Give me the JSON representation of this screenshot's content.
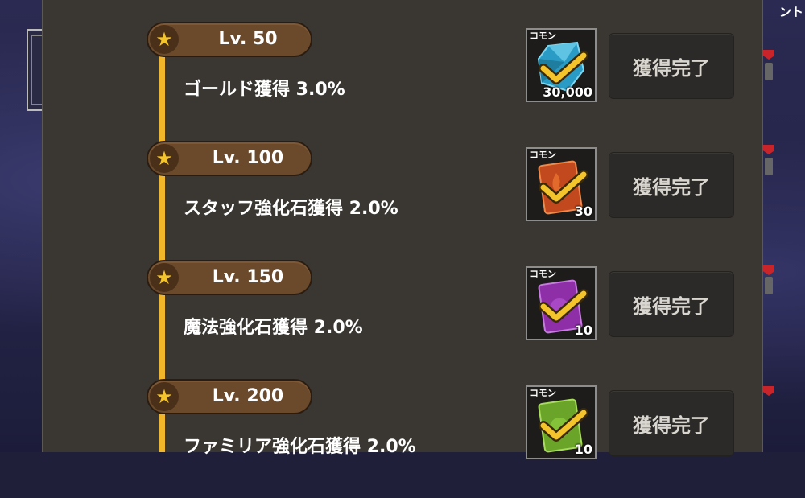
{
  "background": {
    "right_edge_text": "ント"
  },
  "rewards": [
    {
      "level": "Lv. 50",
      "reward": "ゴールド獲得 3.0%",
      "rarity": "コモン",
      "quantity": "30,000",
      "item_icon": "crystal-icon",
      "item_color": "#2a9bc4",
      "status": "獲得完了"
    },
    {
      "level": "Lv. 100",
      "reward": "スタッフ強化石獲得 2.0%",
      "rarity": "コモン",
      "quantity": "30",
      "item_icon": "staff-stone-icon",
      "item_color": "#c2481e",
      "status": "獲得完了"
    },
    {
      "level": "Lv. 150",
      "reward": "魔法強化石獲得 2.0%",
      "rarity": "コモン",
      "quantity": "10",
      "item_icon": "magic-stone-icon",
      "item_color": "#8e2fa8",
      "status": "獲得完了"
    },
    {
      "level": "Lv. 200",
      "reward": "ファミリア強化石獲得 2.0%",
      "rarity": "コモン",
      "quantity": "10",
      "item_icon": "familiar-stone-icon",
      "item_color": "#6aa52a",
      "status": "獲得完了"
    }
  ],
  "colors": {
    "timeline": "#f1b62a",
    "level_pill": "#6b4a2c",
    "panel": "#3a3733",
    "check": "#f4c42c"
  }
}
